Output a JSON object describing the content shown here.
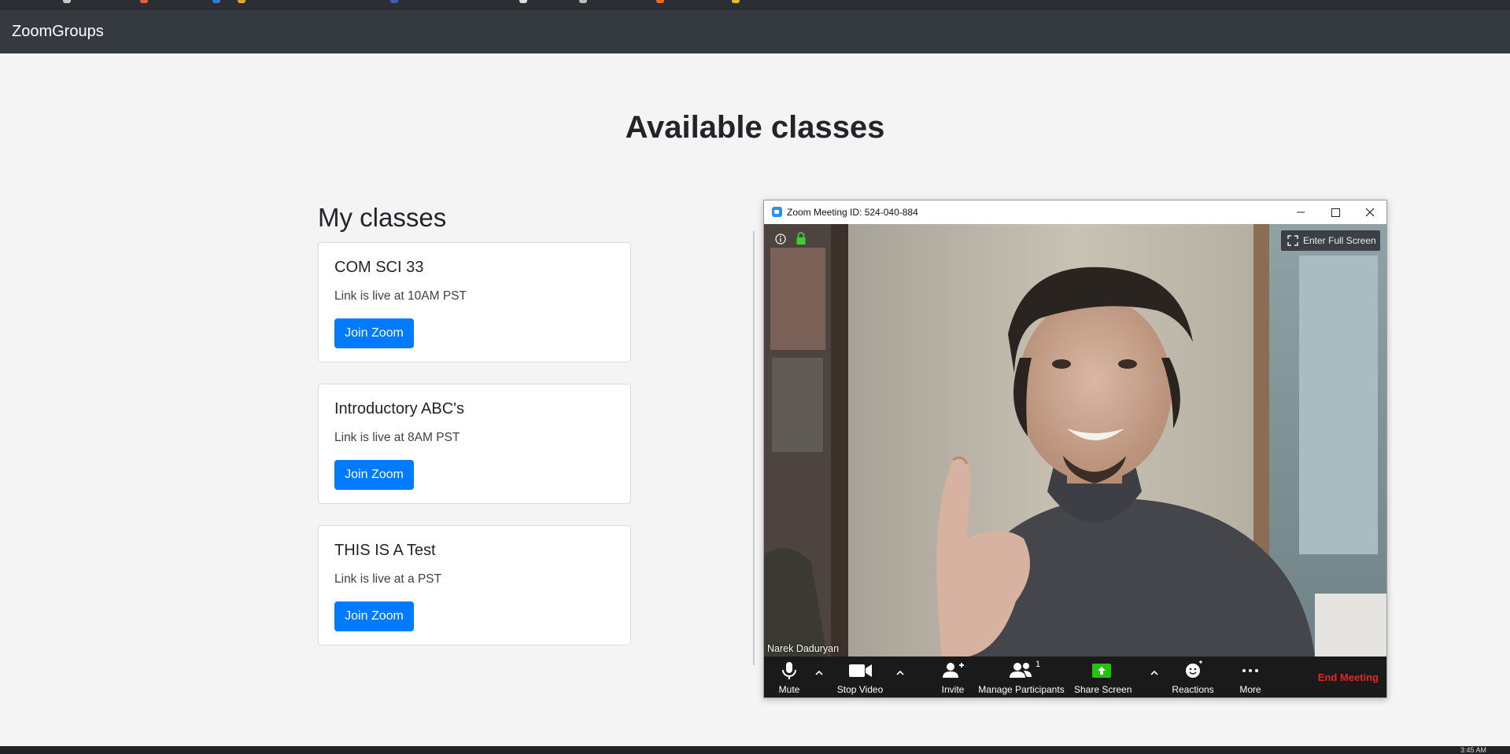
{
  "navbar": {
    "brand": "ZoomGroups"
  },
  "page": {
    "title": "Available classes"
  },
  "my_classes": {
    "heading": "My classes",
    "cards": [
      {
        "title": "COM SCI 33",
        "text": "Link is live at 10AM PST",
        "button": "Join Zoom"
      },
      {
        "title": "Introductory ABC's",
        "text": "Link is live at 8AM PST",
        "button": "Join Zoom"
      },
      {
        "title": "THIS IS A Test",
        "text": "Link is live at a PST",
        "button": "Join Zoom"
      }
    ]
  },
  "zoom_window": {
    "title": "Zoom Meeting ID: 524-040-884",
    "fullscreen_label": "Enter Full Screen",
    "participant_name": "Narek Daduryan",
    "toolbar": {
      "mute": "Mute",
      "stop_video": "Stop Video",
      "invite": "Invite",
      "manage_participants": "Manage Participants",
      "participant_count": "1",
      "share_screen": "Share Screen",
      "reactions": "Reactions",
      "more": "More",
      "end_meeting": "End Meeting"
    }
  },
  "taskbar": {
    "clock": "3:45 AM"
  },
  "colors": {
    "navbar": "#343a40",
    "primary_button": "#007bff",
    "end_meeting": "#e02828",
    "share_screen": "#23c40e"
  }
}
